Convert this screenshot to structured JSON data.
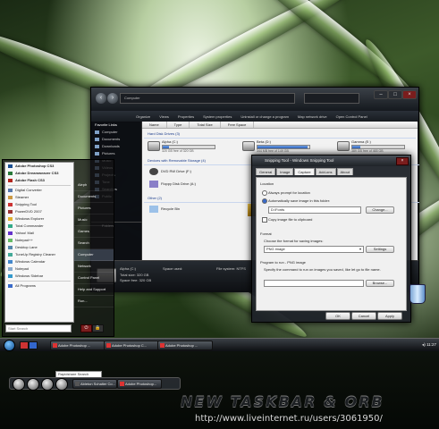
{
  "explorer": {
    "address": "Computer",
    "toolbar": [
      "Organize",
      "Views",
      "Properties",
      "System properties",
      "Uninstall or change a program",
      "Map network drive",
      "Open Control Panel"
    ],
    "favorites_header": "Favorite Links",
    "sidebar_items": [
      "Computer",
      "Documents",
      "Downloads",
      "Pictures",
      "Music",
      "Videos",
      "Projects",
      "Tone",
      "Searches",
      "Public"
    ],
    "folders_label": "Folders",
    "columns": [
      "Name",
      "Type",
      "Total Size",
      "Free Space"
    ],
    "group_hdd": "Hard Disk Drives (3)",
    "drives": [
      {
        "name": "Alpha (C:)",
        "free": "320 GB free of 320 GB",
        "fill": 0.12
      },
      {
        "name": "Beta (D:)",
        "free": "344 MB free of 149 GB",
        "fill": 0.97
      },
      {
        "name": "Gamma (E:)",
        "free": "389 GB free of 465 GB",
        "fill": 0.16
      }
    ],
    "group_removable": "Devices with Removable Storage (4)",
    "devices": [
      "DVD RW Drive (F:)",
      "Floppy Disk Drive (A:)"
    ],
    "group_other": "Other (2)",
    "other": [
      "Recycle Bin"
    ],
    "details": {
      "title": "Alpha (C:)",
      "space_used_label": "Space used:",
      "total_size": "Total size: 320 GB",
      "free": "Space free: 320 GB",
      "fs": "File system: NTFS"
    }
  },
  "dialog": {
    "title": "Snipping Tool - Windows Snipping Tool",
    "tabs": [
      "General",
      "Image",
      "Capture",
      "Add-ons",
      "About"
    ],
    "location_label": "Location",
    "opt_prompt": "Always prompt for location",
    "opt_auto": "Automatically save image in this folder:",
    "folder": "D:\\Fonts",
    "change_btn": "Change...",
    "copy_clipboard": "Copy image file to clipboard",
    "format_label": "Format",
    "format_desc": "Choose the format for saving images:",
    "format_value": "PNG image",
    "settings_btn": "Settings",
    "program_label": "Program to run - PNG image",
    "program_desc": "Specify the command to run on images you saved, like let go to file name.",
    "browse_btn": "Browse...",
    "ok": "OK",
    "cancel": "Cancel",
    "apply": "Apply"
  },
  "startmenu": {
    "pinned": [
      "Adobe Photoshop CS3",
      "Adobe Dreamweaver CS3",
      "Adobe Flash CS3"
    ],
    "recent": [
      "Digital Converter",
      "Steamer",
      "Snipping Tool",
      "PowerDVD 2007",
      "Windows Explorer",
      "Total Commander",
      "Yahoo! Mail",
      "Notepad++",
      "Desktop Lane",
      "TuneUp Registry Cleaner",
      "Windows Calendar",
      "Notepad",
      "Windows Sidebar"
    ],
    "all_programs": "All Programs",
    "right": [
      "Aleph",
      "Documents",
      "Pictures",
      "Music",
      "Games",
      "Search",
      "Computer",
      "Network",
      "Control Panel",
      "Help and Support",
      "Run..."
    ],
    "search_placeholder": "Start Search",
    "power": "⏻",
    "lock": "🔒"
  },
  "taskbar": {
    "buttons": [
      "Adobe Photoshop ...",
      "Adobe Photoshop C...",
      "Adobe Photoshop ..."
    ],
    "clock": "11:27"
  },
  "preview": {
    "search": "Rapidshare Search",
    "buttons": [
      "Ableton Schalter Co...",
      "Adobe Photoshop..."
    ],
    "banner": "NEW TASKBAR & ORB",
    "url": "http://www.liveinternet.ru/users/3061950/"
  },
  "colors": {
    "accent": "#2f63b8",
    "taskbar": "#0d0f12",
    "wallpaper_green": "#3d5a2a"
  }
}
